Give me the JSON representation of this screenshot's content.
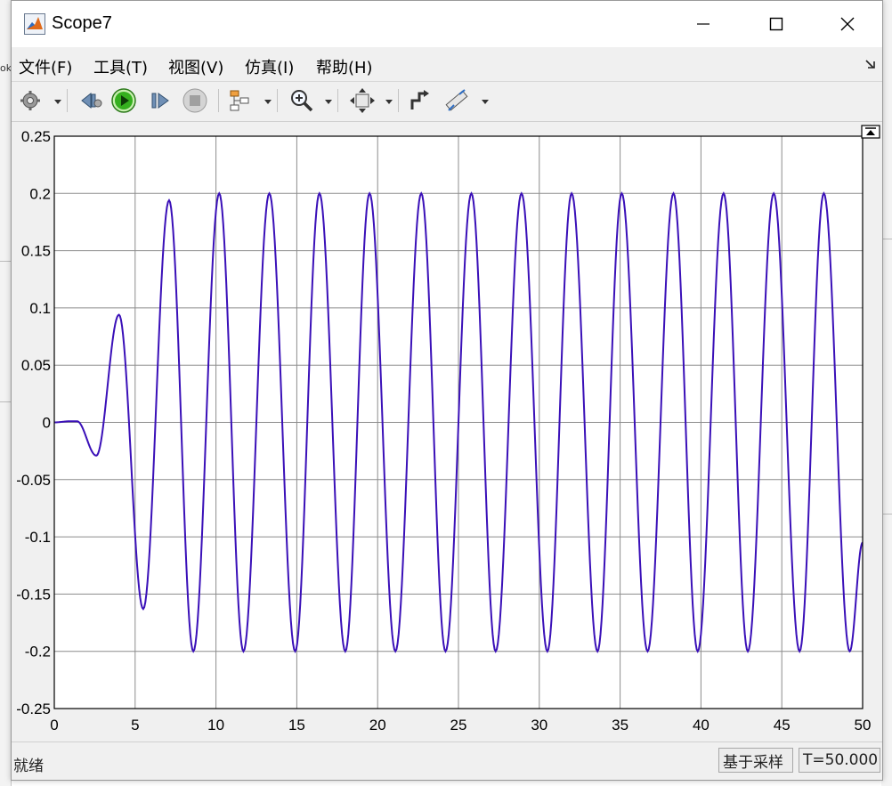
{
  "window": {
    "title": "Scope7"
  },
  "menu": [
    {
      "label": "文件(F)"
    },
    {
      "label": "工具(T)"
    },
    {
      "label": "视图(V)"
    },
    {
      "label": "仿真(I)"
    },
    {
      "label": "帮助(H)"
    }
  ],
  "toolbar": {
    "icons": [
      "settings-icon",
      "step-back-icon",
      "run-icon",
      "step-forward-icon",
      "stop-icon",
      "highlight-block-icon",
      "zoom-in-icon",
      "fit-view-icon",
      "restore-layout-icon",
      "measure-icon"
    ]
  },
  "status": {
    "text": "就绪",
    "mode": "基于采样",
    "time": "T=50.000"
  },
  "colors": {
    "signal": "#3a10b8",
    "axes_bg": "#ffffff",
    "grid": "#8c8c8c"
  },
  "chart_data": {
    "type": "line",
    "title": "",
    "xlabel": "",
    "ylabel": "",
    "xlim": [
      0,
      50
    ],
    "ylim": [
      -0.25,
      0.25
    ],
    "grid": true,
    "x_ticks": [
      "0",
      "5",
      "10",
      "15",
      "20",
      "25",
      "30",
      "35",
      "40",
      "45",
      "50"
    ],
    "y_ticks": [
      "0.25",
      "0.2",
      "0.15",
      "0.1",
      "0.05",
      "0",
      "-0.05",
      "-0.1",
      "-0.15",
      "-0.2",
      "-0.25"
    ],
    "series": [
      {
        "name": "",
        "x": [
          0,
          1.0,
          1.4,
          2.6,
          4.0,
          5.5,
          7.1,
          8.6,
          10.2,
          11.7,
          13.3,
          14.9,
          16.4,
          18.0,
          19.5,
          21.1,
          22.7,
          24.2,
          25.8,
          27.3,
          28.9,
          30.5,
          32.0,
          33.6,
          35.1,
          36.7,
          38.3,
          39.8,
          41.4,
          42.9,
          44.5,
          46.1,
          47.6,
          49.2,
          50
        ],
        "y": [
          0,
          0.001,
          0.001,
          -0.029,
          0.094,
          -0.163,
          0.194,
          -0.2,
          0.2,
          -0.2,
          0.2,
          -0.2,
          0.2,
          -0.2,
          0.2,
          -0.2,
          0.2,
          -0.2,
          0.2,
          -0.2,
          0.2,
          -0.2,
          0.2,
          -0.2,
          0.2,
          -0.2,
          0.2,
          -0.2,
          0.2,
          -0.2,
          0.2,
          -0.2,
          0.2,
          -0.2,
          -0.105
        ]
      }
    ]
  }
}
